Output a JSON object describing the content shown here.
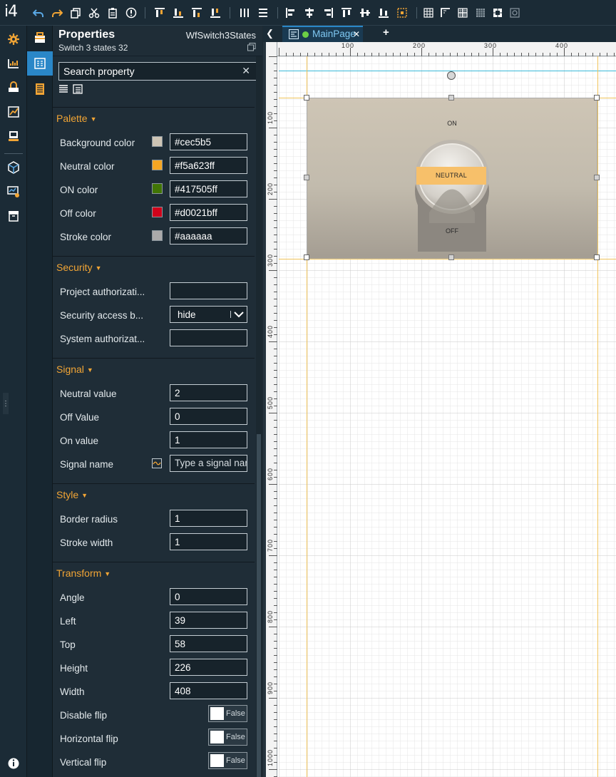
{
  "app": {
    "logo": "i4"
  },
  "toolbar": {
    "icons": [
      "undo-icon",
      "redo-icon",
      "copy-icon",
      "cut-icon",
      "paste-icon",
      "info-icon",
      "align-top-icon",
      "align-bottom-icon",
      "align-top-to-bottom-icon",
      "align-bottom-to-top-icon",
      "distribute-horizontal-icon",
      "distribute-vertical-icon",
      "align-left-icon",
      "align-center-horizontal-icon",
      "align-right-icon",
      "align-top-edge-icon",
      "align-center-vertical-icon",
      "align-bottom-edge-icon",
      "align-center-both-icon",
      "grid-icon",
      "snap-corner-icon",
      "grid-dense-icon",
      "grid-fine-icon",
      "grid-cells-icon",
      "zoom-fit-icon"
    ]
  },
  "properties": {
    "title": "Properties",
    "component_type": "WfSwitch3States",
    "component_name": "Switch 3 states 32",
    "search_placeholder": "Search property",
    "sections": {
      "palette": {
        "label": "Palette",
        "rows": [
          {
            "label": "Background color",
            "value": "#cec5b5",
            "swatch": "#cec5b5"
          },
          {
            "label": "Neutral color",
            "value": "#f5a623ff",
            "swatch": "#f5a623"
          },
          {
            "label": "ON color",
            "value": "#417505ff",
            "swatch": "#417505"
          },
          {
            "label": "Off color",
            "value": "#d0021bff",
            "swatch": "#d0021b"
          },
          {
            "label": "Stroke color",
            "value": "#aaaaaa",
            "swatch": "#aaaaaa"
          }
        ]
      },
      "security": {
        "label": "Security",
        "rows": [
          {
            "label": "Project authorizati...",
            "value": ""
          },
          {
            "label": "Security access b...",
            "value": "hide"
          },
          {
            "label": "System authorizat...",
            "value": ""
          }
        ]
      },
      "signal": {
        "label": "Signal",
        "rows": [
          {
            "label": "Neutral value",
            "value": "2"
          },
          {
            "label": "Off Value",
            "value": "0"
          },
          {
            "label": "On value",
            "value": "1"
          },
          {
            "label": "Signal name",
            "value": "",
            "placeholder": "Type a signal name"
          }
        ]
      },
      "style": {
        "label": "Style",
        "rows": [
          {
            "label": "Border radius",
            "value": "1"
          },
          {
            "label": "Stroke width",
            "value": "1"
          }
        ]
      },
      "transform": {
        "label": "Transform",
        "rows": [
          {
            "label": "Angle",
            "value": "0"
          },
          {
            "label": "Left",
            "value": "39"
          },
          {
            "label": "Top",
            "value": "58"
          },
          {
            "label": "Height",
            "value": "226"
          },
          {
            "label": "Width",
            "value": "408"
          }
        ],
        "toggles": [
          {
            "label": "Disable flip",
            "value": "False"
          },
          {
            "label": "Horizontal flip",
            "value": "False"
          },
          {
            "label": "Vertical flip",
            "value": "False"
          }
        ]
      }
    }
  },
  "tabs": {
    "main": "MainPage"
  },
  "rulers": {
    "top": [
      "100",
      "200",
      "300",
      "400"
    ],
    "left": [
      "100",
      "200",
      "300",
      "400",
      "500",
      "600",
      "700",
      "800",
      "900",
      "1000"
    ]
  },
  "widget": {
    "on_label": "ON",
    "off_label": "OFF",
    "neutral_label": "NEUTRAL",
    "background": "#cec5b5",
    "neutral_color": "#f5a623"
  },
  "colors": {
    "accent": "#f2a535",
    "active": "#2a87c8",
    "guide_cyan": "#39b8d8",
    "guide_yellow": "#f0c35a"
  }
}
